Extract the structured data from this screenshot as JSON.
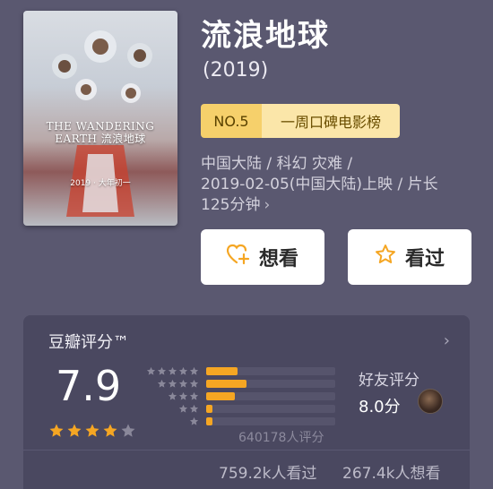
{
  "poster": {
    "title": "THE WANDERING EARTH 流浪地球",
    "tagline": "2019 · 大年初一"
  },
  "movie": {
    "title": "流浪地球",
    "year": "(2019)",
    "meta_lines": [
      "中国大陆 / 科幻 灾难 /",
      "2019-02-05(中国大陆)上映 / 片长",
      "125分钟"
    ]
  },
  "rank": {
    "no": "NO.5",
    "name": "一周口碑电影榜"
  },
  "buttons": {
    "want": "想看",
    "seen": "看过"
  },
  "rating": {
    "title": "豆瓣评分™",
    "score": "7.9",
    "star_level": 4,
    "star_max": 5,
    "distribution_percent": [
      24,
      31,
      22,
      5,
      5
    ],
    "votes": "640178人评分",
    "friends_label": "好友评分",
    "friends_score": "8.0分",
    "watched": "759.2k人看过",
    "wanting": "267.4k人想看"
  },
  "colors": {
    "background": "#5a5870",
    "card": "#4a4860",
    "accent": "#f5a623",
    "badge_dark": "#f6d06b",
    "badge_light": "#fbe6a9"
  },
  "icons": {
    "want": "heart-plus-icon",
    "seen": "star-outline-icon",
    "chevron": "chevron-right-icon"
  }
}
